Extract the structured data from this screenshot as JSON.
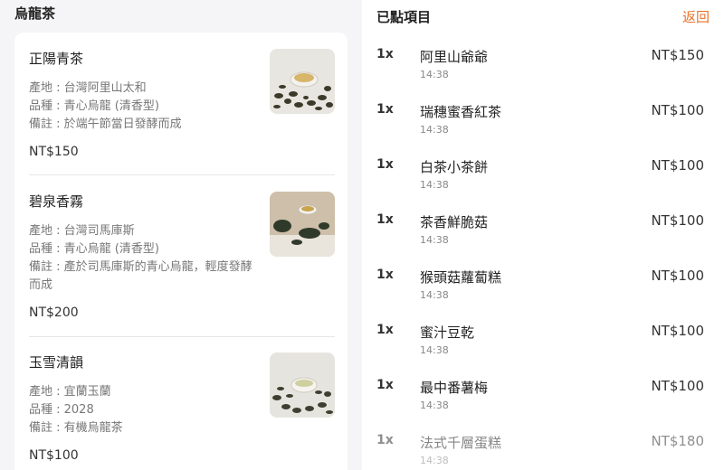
{
  "menu": {
    "category_title": "烏龍茶",
    "items": [
      {
        "name": "正陽青茶",
        "origin": "產地 : 台灣阿里山太和",
        "variety": "品種 : 青心烏龍 (清香型)",
        "note": "備註 : 於端午節當日發酵而成",
        "price": "NT$150",
        "image": "tea-leaves-with-cup-icon"
      },
      {
        "name": "碧泉香霧",
        "origin": "產地 : 台灣司馬庫斯",
        "variety": "品種 : 青心烏龍 (清香型)",
        "note": "備註 : 產於司馬庫斯的青心烏龍，輕度發酵而成",
        "price": "NT$200",
        "image": "tea-leaves-with-cup-icon"
      },
      {
        "name": "玉雪清韻",
        "origin": "產地 : 宜蘭玉蘭",
        "variety": "品種 : 2028",
        "note": "備註 : 有機烏龍茶",
        "price": "NT$100",
        "image": "tea-leaves-with-cup-icon"
      }
    ]
  },
  "orders": {
    "title": "已點項目",
    "back_label": "返回",
    "items": [
      {
        "qty": "1x",
        "name": "阿里山爺爺",
        "time": "14:38",
        "price": "NT$150"
      },
      {
        "qty": "1x",
        "name": "瑞穗蜜香紅茶",
        "time": "14:38",
        "price": "NT$100"
      },
      {
        "qty": "1x",
        "name": "白茶小茶餅",
        "time": "14:38",
        "price": "NT$100"
      },
      {
        "qty": "1x",
        "name": "茶香鮮脆菇",
        "time": "14:38",
        "price": "NT$100"
      },
      {
        "qty": "1x",
        "name": "猴頭菇蘿蔔糕",
        "time": "14:38",
        "price": "NT$100"
      },
      {
        "qty": "1x",
        "name": "蜜汁豆乾",
        "time": "14:38",
        "price": "NT$100"
      },
      {
        "qty": "1x",
        "name": "最中番薯梅",
        "time": "14:38",
        "price": "NT$100"
      },
      {
        "qty": "1x",
        "name": "法式千層蛋糕",
        "time": "14:38",
        "price": "NT$180"
      }
    ]
  },
  "colors": {
    "accent": "#e8742a",
    "panel_bg": "#f5f5f7"
  }
}
